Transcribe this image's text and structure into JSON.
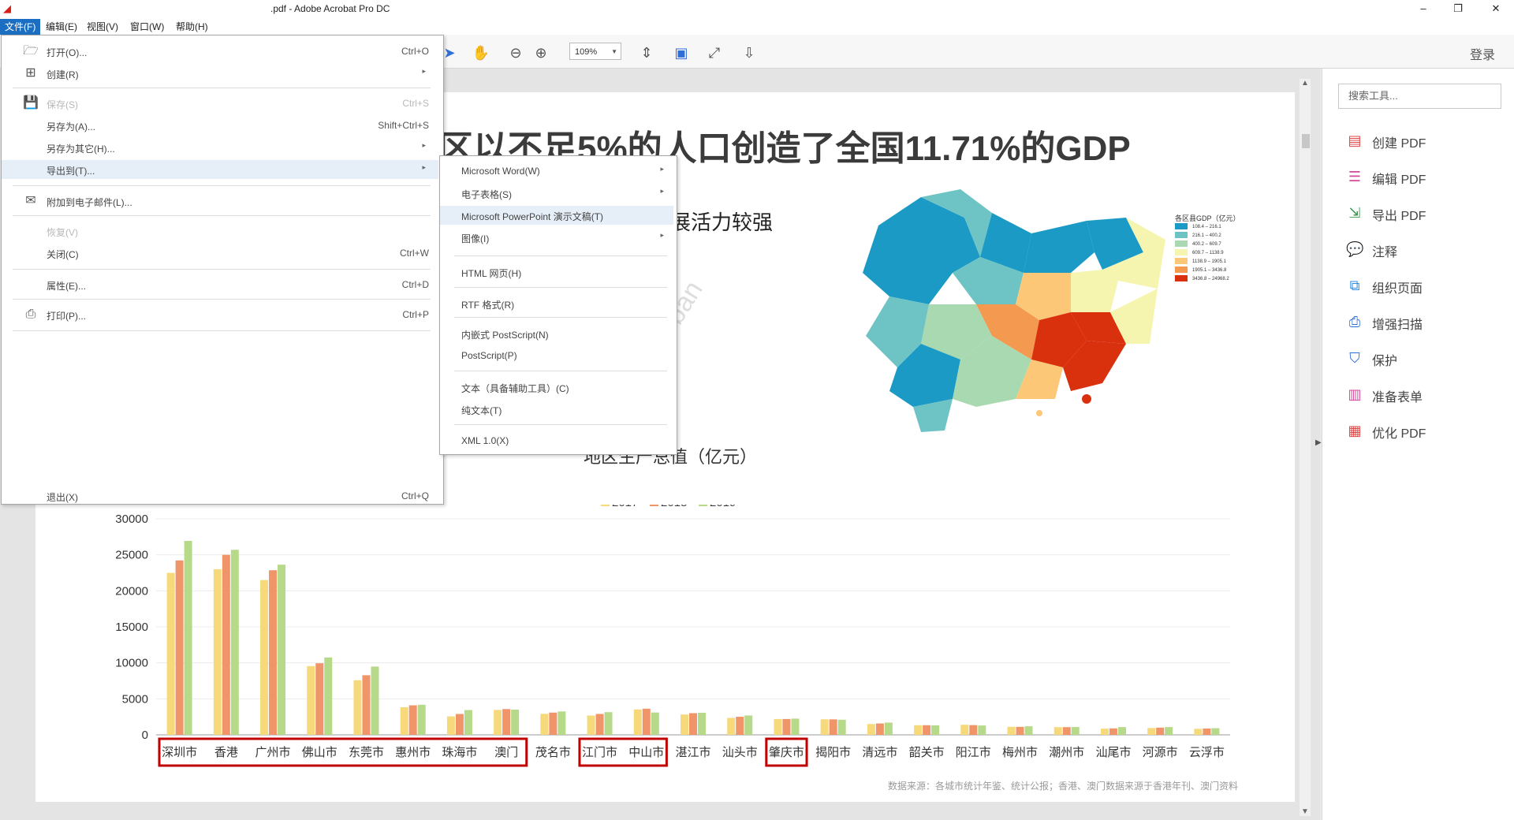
{
  "window": {
    "title": ".pdf - Adobe Acrobat Pro DC",
    "minimize": "–",
    "restore": "❐",
    "close": "✕"
  },
  "menubar": [
    {
      "label": "文件(F)"
    },
    {
      "label": "编辑(E)"
    },
    {
      "label": "视图(V)"
    },
    {
      "label": "窗口(W)"
    },
    {
      "label": "帮助(H)"
    }
  ],
  "toolbar": {
    "zoom": "109%",
    "signin": "登录"
  },
  "file_menu": [
    {
      "label": "打开(O)...",
      "shortcut": "Ctrl+O",
      "icon": "open-folder-icon"
    },
    {
      "label": "创建(R)",
      "submenu": true,
      "icon": "create-icon"
    },
    {
      "label": "保存(S)",
      "shortcut": "Ctrl+S",
      "disabled": true,
      "icon": "save-icon"
    },
    {
      "label": "另存为(A)...",
      "shortcut": "Shift+Ctrl+S"
    },
    {
      "label": "另存为其它(H)...",
      "submenu": true
    },
    {
      "label": "导出到(T)...",
      "submenu": true,
      "highlighted": true
    },
    {
      "label": "附加到电子邮件(L)...",
      "icon": "email-icon"
    },
    {
      "label": "恢复(V)",
      "disabled": true
    },
    {
      "label": "关闭(C)",
      "shortcut": "Ctrl+W"
    },
    {
      "label": "属性(E)...",
      "shortcut": "Ctrl+D"
    },
    {
      "label": "打印(P)...",
      "shortcut": "Ctrl+P",
      "icon": "print-icon"
    },
    {
      "label": "退出(X)",
      "shortcut": "Ctrl+Q"
    }
  ],
  "export_menu": [
    {
      "label": "Microsoft Word(W)",
      "submenu": true
    },
    {
      "label": "电子表格(S)",
      "submenu": true
    },
    {
      "label": "Microsoft PowerPoint 演示文稿(T)",
      "highlighted": true
    },
    {
      "label": "图像(I)",
      "submenu": true
    },
    {
      "label": "HTML 网页(H)"
    },
    {
      "label": "RTF 格式(R)"
    },
    {
      "label": "内嵌式 PostScript(N)"
    },
    {
      "label": "PostScript(P)"
    },
    {
      "label": "文本（具备辅助工具）(C)"
    },
    {
      "label": "纯文本(T)"
    },
    {
      "label": "XML 1.0(X)"
    }
  ],
  "right_pane": {
    "search_placeholder": "搜索工具...",
    "tools": [
      {
        "label": "创建 PDF",
        "icon": "create-pdf-icon",
        "color": "#e04848"
      },
      {
        "label": "编辑 PDF",
        "icon": "edit-pdf-icon",
        "color": "#d6489a"
      },
      {
        "label": "导出 PDF",
        "icon": "export-pdf-icon",
        "color": "#3a9a4a"
      },
      {
        "label": "注释",
        "icon": "comment-icon",
        "color": "#f0a81e"
      },
      {
        "label": "组织页面",
        "icon": "organize-pages-icon",
        "color": "#2d8be0"
      },
      {
        "label": "增强扫描",
        "icon": "enhance-scan-icon",
        "color": "#2d6fd6"
      },
      {
        "label": "保护",
        "icon": "protect-icon",
        "color": "#2d6fd6"
      },
      {
        "label": "准备表单",
        "icon": "prepare-form-icon",
        "color": "#d6489a"
      },
      {
        "label": "优化 PDF",
        "icon": "optimize-pdf-icon",
        "color": "#e04848"
      }
    ]
  },
  "document": {
    "headline": "区以不足5%的人口创造了全国11.71%的GDP",
    "subtitle": "展活力较强",
    "watermark": "©QuodUrban",
    "source": "数据来源：各城市统计年鉴、统计公报；香港、澳门数据来源于香港年刊、澳门资料",
    "map_legend": {
      "title": "各区县GDP（亿元）",
      "ranges": [
        {
          "label": "108.4 – 216.1",
          "color": "#1a9ac4"
        },
        {
          "label": "216.1 – 400.2",
          "color": "#6ec4c4"
        },
        {
          "label": "400.2 – 609.7",
          "color": "#a8d9b0"
        },
        {
          "label": "609.7 – 1138.9",
          "color": "#f6f5b0"
        },
        {
          "label": "1138.9 – 1905.1",
          "color": "#fcc878"
        },
        {
          "label": "1905.1 – 3436.8",
          "color": "#f49a50"
        },
        {
          "label": "3436.8 – 24968.2",
          "color": "#d9300e"
        }
      ]
    }
  },
  "chart_data": {
    "type": "bar",
    "title": "地区生产总值（亿元）",
    "categories": [
      "深圳市",
      "香港",
      "广州市",
      "佛山市",
      "东莞市",
      "惠州市",
      "珠海市",
      "澳门",
      "茂名市",
      "江门市",
      "中山市",
      "湛江市",
      "汕头市",
      "肇庆市",
      "揭阳市",
      "清远市",
      "韶关市",
      "阳江市",
      "梅州市",
      "潮州市",
      "汕尾市",
      "河源市",
      "云浮市"
    ],
    "series": [
      {
        "name": "2017",
        "color": "#f5d97a",
        "values": [
          22490,
          23000,
          21500,
          9550,
          7580,
          3830,
          2560,
          3460,
          2920,
          2690,
          3530,
          2820,
          2350,
          2200,
          2160,
          1500,
          1340,
          1400,
          1120,
          1070,
          860,
          950,
          840
        ]
      },
      {
        "name": "2018",
        "color": "#f0946a",
        "values": [
          24220,
          25000,
          22860,
          9940,
          8280,
          4100,
          2900,
          3580,
          3090,
          2900,
          3630,
          3010,
          2510,
          2200,
          2150,
          1580,
          1340,
          1350,
          1110,
          1070,
          900,
          1000,
          880
        ]
      },
      {
        "name": "2019",
        "color": "#b6d98a",
        "values": [
          26930,
          25700,
          23630,
          10750,
          9480,
          4180,
          3440,
          3500,
          3250,
          3150,
          3100,
          3060,
          2690,
          2250,
          2100,
          1700,
          1320,
          1300,
          1190,
          1080,
          1080,
          1080,
          920
        ]
      }
    ],
    "ylim": [
      0,
      30000
    ],
    "yticks": [
      "30000",
      "25000",
      "20000",
      "15000",
      "10000",
      "5000",
      "0"
    ],
    "legend": "top-center",
    "grid": true,
    "highlight_groups": [
      [
        0,
        7
      ],
      [
        9,
        10
      ],
      [
        13,
        13
      ]
    ],
    "highlight_color": "#c00000"
  }
}
